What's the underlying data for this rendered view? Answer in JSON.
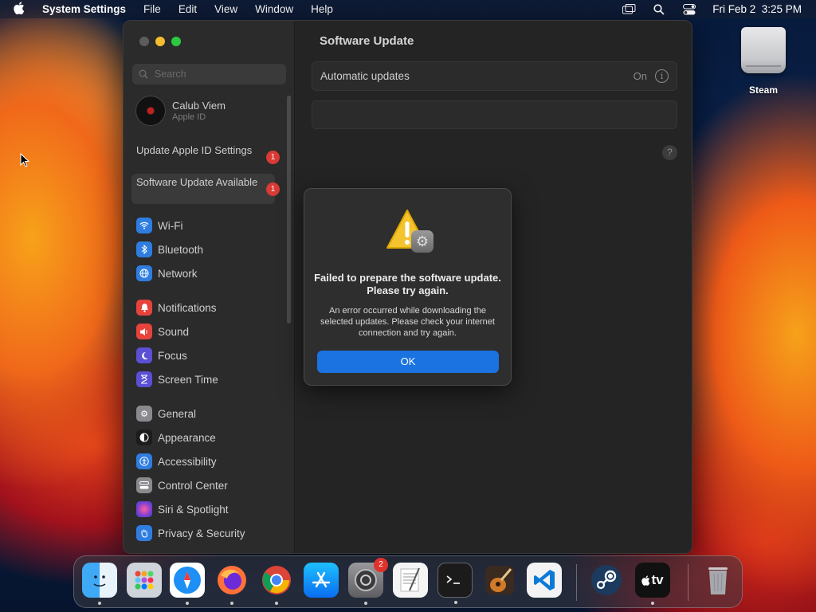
{
  "menubar": {
    "app_name": "System Settings",
    "menus": [
      "File",
      "Edit",
      "View",
      "Window",
      "Help"
    ],
    "clock": "Fri Feb 2  3:25 PM"
  },
  "desktop": {
    "icon_label": "Steam"
  },
  "window": {
    "search": {
      "placeholder": "Search"
    },
    "profile": {
      "name": "Calub Viem",
      "subtitle": "Apple ID"
    },
    "alerts": [
      {
        "label": "Update Apple ID Settings",
        "badge": "1"
      },
      {
        "label": "Software Update Available",
        "badge": "1"
      }
    ],
    "sidebar": {
      "group1": [
        {
          "label": "Wi-Fi",
          "icon": "wifi-icon",
          "color": "#2f7de1"
        },
        {
          "label": "Bluetooth",
          "icon": "bluetooth-icon",
          "color": "#2f7de1"
        },
        {
          "label": "Network",
          "icon": "globe-icon",
          "color": "#2f7de1"
        }
      ],
      "group2": [
        {
          "label": "Notifications",
          "icon": "bell-icon",
          "color": "#e5433c"
        },
        {
          "label": "Sound",
          "icon": "speaker-icon",
          "color": "#e5433c"
        },
        {
          "label": "Focus",
          "icon": "moon-icon",
          "color": "#5b4fd6"
        },
        {
          "label": "Screen Time",
          "icon": "hourglass-icon",
          "color": "#5b4fd6"
        }
      ],
      "group3": [
        {
          "label": "General",
          "icon": "gear-icon",
          "color": "#8a8a8e"
        },
        {
          "label": "Appearance",
          "icon": "appearance-icon",
          "color": "#1c1c1e"
        },
        {
          "label": "Accessibility",
          "icon": "accessibility-icon",
          "color": "#2f7de1"
        },
        {
          "label": "Control Center",
          "icon": "control-center-icon",
          "color": "#8a8a8e"
        },
        {
          "label": "Siri & Spotlight",
          "icon": "siri-icon",
          "color": "#c04fd6"
        },
        {
          "label": "Privacy & Security",
          "icon": "hand-icon",
          "color": "#2f7de1"
        }
      ]
    },
    "content": {
      "title": "Software Update",
      "automatic_label": "Automatic updates",
      "automatic_value": "On"
    }
  },
  "dialog": {
    "title": "Failed to prepare the software update. Please try again.",
    "message": "An error occurred while downloading the selected updates. Please check your internet connection and try again.",
    "ok_label": "OK"
  },
  "dock": {
    "apps": [
      {
        "name": "finder-icon"
      },
      {
        "name": "launchpad-icon"
      },
      {
        "name": "safari-icon"
      },
      {
        "name": "firefox-icon"
      },
      {
        "name": "chrome-icon"
      },
      {
        "name": "app-store-icon"
      },
      {
        "name": "system-settings-icon",
        "badge": "2"
      },
      {
        "name": "textedit-icon"
      },
      {
        "name": "terminal-icon"
      },
      {
        "name": "garageband-icon"
      },
      {
        "name": "vscode-icon"
      },
      {
        "name": "steam-icon"
      },
      {
        "name": "apple-tv-icon"
      },
      {
        "name": "trash-icon"
      }
    ],
    "tv_label": "tv"
  }
}
